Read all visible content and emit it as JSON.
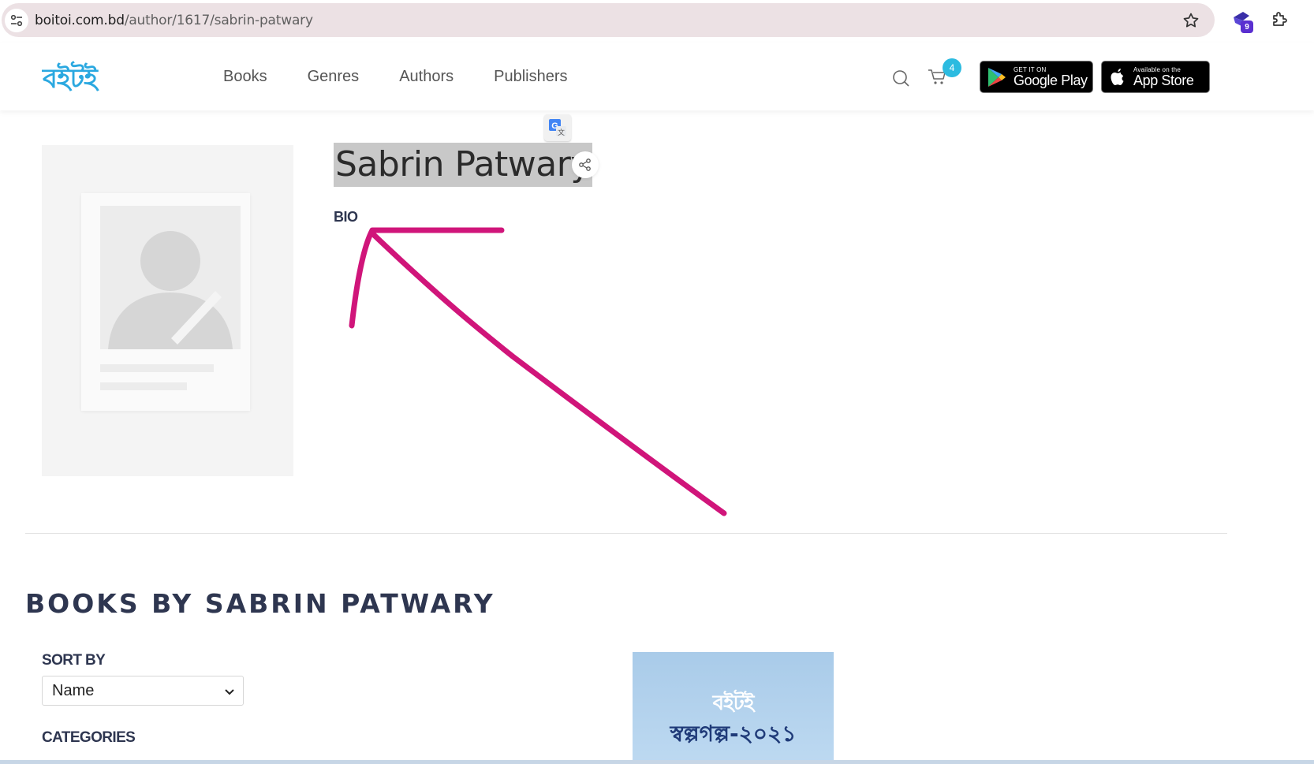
{
  "browser": {
    "url_host": "boitoi.com.bd",
    "url_path": "/author/1617/sabrin-patwary",
    "extension_badge": "9"
  },
  "site": {
    "logo_text": "বইটই",
    "nav": [
      "Books",
      "Genres",
      "Authors",
      "Publishers"
    ],
    "cart_count": "4",
    "google_play": {
      "small": "GET IT ON",
      "big": "Google Play"
    },
    "app_store": {
      "small": "Available on the",
      "big": "App Store"
    }
  },
  "author": {
    "name": "Sabrin Patwary",
    "bio_label": "BIO"
  },
  "annotation": {
    "arrow_color": "#d0157a"
  },
  "books_section": {
    "heading": "BOOKS BY SABRIN PATWARY",
    "sort_label": "SORT BY",
    "sort_value": "Name",
    "categories_label": "CATEGORIES",
    "book_cover": {
      "logo": "বইটই",
      "title": "স্বল্পগল্প-২০২১"
    }
  },
  "colors": {
    "accent": "#2aa8e0",
    "heading": "#2e3650",
    "url_bar": "#ece1e4"
  }
}
